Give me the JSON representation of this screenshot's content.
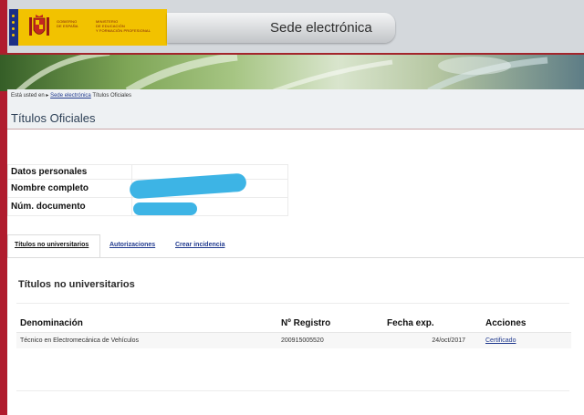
{
  "header": {
    "logo_text_col1": [
      "GOBIERNO",
      "DE ESPAÑA"
    ],
    "logo_text_col2": [
      "MINISTERIO",
      "DE EDUCACIÓN",
      "Y FORMACIÓN PROFESIONAL"
    ],
    "site_title": "Sede electrónica",
    "colors": {
      "brand_yellow": "#f2c200",
      "brand_red": "#b01c2e",
      "flag_blue": "#1b2f85"
    }
  },
  "breadcrumb": {
    "prefix": "Está usted en",
    "items": [
      "Sede electrónica",
      "Títulos Oficiales"
    ]
  },
  "page_title": "Títulos Oficiales",
  "personal_data": {
    "heading": "Datos personales",
    "rows": [
      {
        "label": "Nombre completo",
        "value_redacted": true
      },
      {
        "label": "Núm. documento",
        "value_redacted": true
      }
    ]
  },
  "tabs": [
    {
      "label": "Títulos no universitarios",
      "active": true
    },
    {
      "label": "Autorizaciones",
      "active": false
    },
    {
      "label": "Crear incidencia",
      "active": false
    }
  ],
  "section": {
    "title": "Títulos no universitarios",
    "columns": [
      "Denominación",
      "Nº Registro",
      "Fecha exp.",
      "Acciones"
    ],
    "rows": [
      {
        "denominacion": "Técnico en Electromecánica de Vehículos",
        "registro": "200915005520",
        "fecha": "24/oct/2017",
        "accion": "Certificado"
      }
    ]
  }
}
